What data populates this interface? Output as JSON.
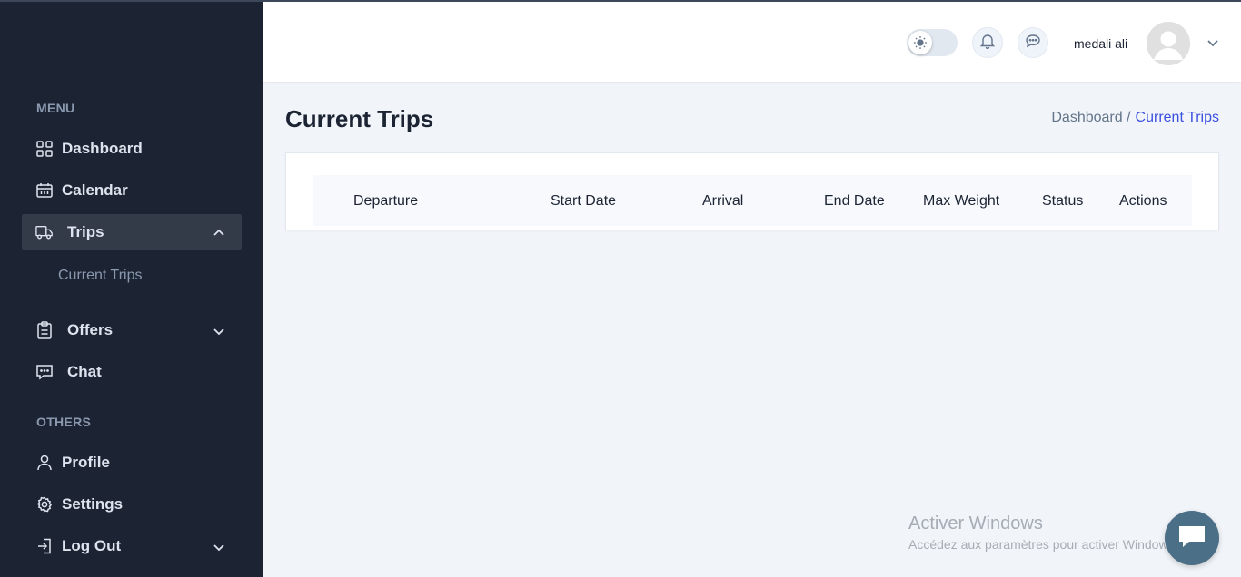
{
  "sidebar": {
    "section_menu": "MENU",
    "section_others": "OTHERS",
    "items": {
      "dashboard": "Dashboard",
      "calendar": "Calendar",
      "trips": "Trips",
      "current_trips": "Current Trips",
      "offers": "Offers",
      "chat": "Chat",
      "profile": "Profile",
      "settings": "Settings",
      "logout": "Log Out"
    },
    "active_item": "Trips"
  },
  "header": {
    "theme_toggle_icon": "sun-icon",
    "notification_icon": "bell-icon",
    "messages_icon": "chat-bubble-icon",
    "user_name": "medali ali",
    "avatar_icon": "user-avatar-icon"
  },
  "page": {
    "title": "Current Trips",
    "breadcrumb_parent": "Dashboard /",
    "breadcrumb_current": "Current Trips"
  },
  "table": {
    "columns": [
      "Departure",
      "Start Date",
      "Arrival",
      "End Date",
      "Max Weight",
      "Status",
      "Actions"
    ],
    "rows": []
  },
  "watermark": {
    "title": "Activer Windows",
    "subtitle": "Accédez aux paramètres pour activer Windows."
  },
  "colors": {
    "sidebar_bg": "#1c2434",
    "active_item_bg": "#333a48",
    "accent": "#3c50e0",
    "page_bg": "#f1f5f9"
  }
}
